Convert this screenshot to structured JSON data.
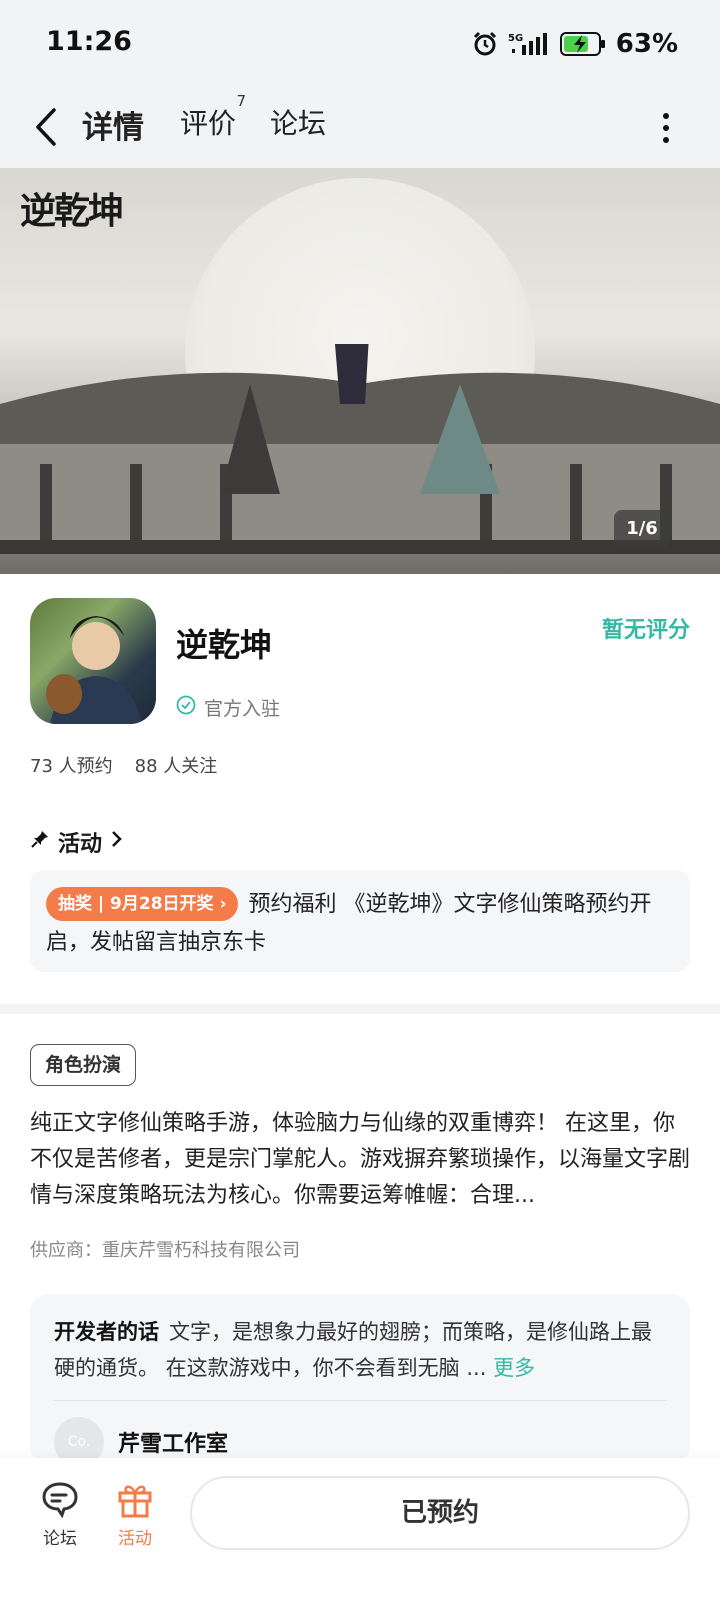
{
  "status_bar": {
    "time": "11:26",
    "network": "5G",
    "battery": "63%",
    "icons": [
      "alarm-icon",
      "signal-icon",
      "battery-charging-icon"
    ]
  },
  "header": {
    "tabs": [
      {
        "label": "详情",
        "active": true
      },
      {
        "label": "评价",
        "badge": "7"
      },
      {
        "label": "论坛"
      }
    ],
    "accent_color": "#3fd3c1"
  },
  "hero": {
    "logo_text": "逆乾坤",
    "counter": "1/6"
  },
  "app": {
    "name": "逆乾坤",
    "rating_text": "暂无评分",
    "official_label": "官方入驻",
    "stats": {
      "reservations": "73 人预约",
      "followers": "88 人关注"
    }
  },
  "activity": {
    "title": "活动",
    "pill": "抽奖 | 9月28日开奖",
    "text": "预约福利 《逆乾坤》文字修仙策略预约开启，发帖留言抽京东卡"
  },
  "description": {
    "tag": "角色扮演",
    "text": "纯正文字修仙策略手游，体验脑力与仙缘的双重博弈！ 在这里，你不仅是苦修者，更是宗门掌舵人。游戏摒弃繁琐操作，以海量文字剧情与深度策略玩法为核心。你需要运筹帷幄：合理...",
    "supplier": "供应商：重庆芹雪朽科技有限公司"
  },
  "developer": {
    "label": "开发者的话",
    "text": "文字，是想象力最好的翅膀；而策略，是修仙路上最硬的通货。 在这款游戏中，你不会看到无脑 ...",
    "more": "更多",
    "studio_name": "芹雪工作室",
    "avatar_text": "Co."
  },
  "bottom_bar": {
    "forum_label": "论坛",
    "activity_label": "活动",
    "reserve_label": "已预约",
    "activity_color": "#f47b4a"
  }
}
